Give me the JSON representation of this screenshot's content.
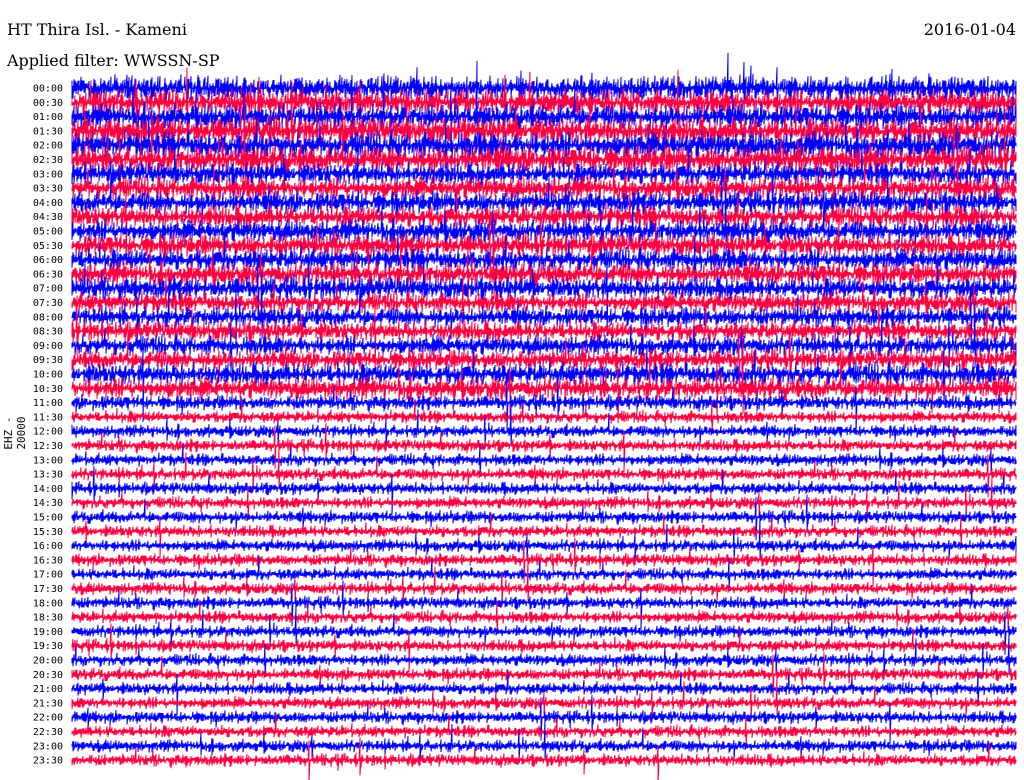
{
  "header": {
    "title": "HT Thira Isl. - Kameni",
    "filter": "Applied filter: WWSSN-SP",
    "date": "2016-01-04"
  },
  "chart_data": {
    "type": "line",
    "title": "HT Thira Isl. - Kameni",
    "subtitle": "Applied filter: WWSSN-SP",
    "ylabel": "EHZ - 20000",
    "date": "2016-01-04",
    "trace_colors": [
      "#0000ff",
      "#ff0040"
    ],
    "row_interval_minutes": 30,
    "row_labels": [
      "00:00",
      "00:30",
      "01:00",
      "01:30",
      "02:00",
      "02:30",
      "03:00",
      "03:30",
      "04:00",
      "04:30",
      "05:00",
      "05:30",
      "06:00",
      "06:30",
      "07:00",
      "07:30",
      "08:00",
      "08:30",
      "09:00",
      "09:30",
      "10:00",
      "10:30",
      "11:00",
      "11:30",
      "12:00",
      "12:30",
      "13:00",
      "13:30",
      "14:00",
      "14:30",
      "15:00",
      "15:30",
      "16:00",
      "16:30",
      "17:00",
      "17:30",
      "18:00",
      "18:30",
      "19:00",
      "19:30",
      "20:00",
      "20:30",
      "21:00",
      "21:30",
      "22:00",
      "22:30",
      "23:00",
      "23:30"
    ],
    "relative_noise_level": [
      1.0,
      1.0,
      1.0,
      1.1,
      1.1,
      1.1,
      0.9,
      0.9,
      0.9,
      0.9,
      0.9,
      0.9,
      0.9,
      0.9,
      0.9,
      0.8,
      0.8,
      0.8,
      0.8,
      0.8,
      0.9,
      0.9,
      0.6,
      0.5,
      0.5,
      0.5,
      0.5,
      0.5,
      0.5,
      0.5,
      0.5,
      0.5,
      0.5,
      0.5,
      0.5,
      0.5,
      0.5,
      0.5,
      0.5,
      0.5,
      0.5,
      0.5,
      0.5,
      0.5,
      0.5,
      0.5,
      0.5,
      0.5
    ]
  }
}
